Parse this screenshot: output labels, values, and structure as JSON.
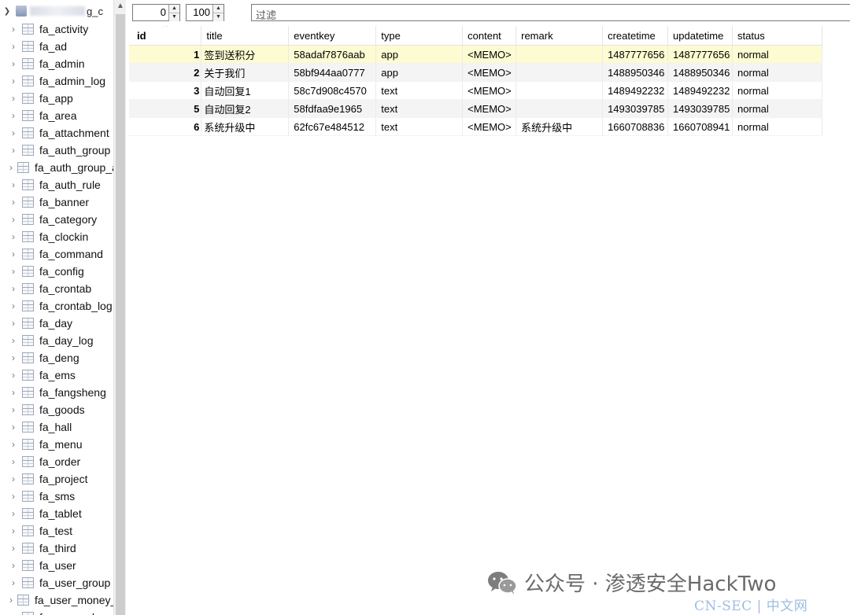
{
  "sidebar": {
    "db_name_tail": "g_c",
    "tables": [
      "fa_activity",
      "fa_ad",
      "fa_admin",
      "fa_admin_log",
      "fa_app",
      "fa_area",
      "fa_attachment",
      "fa_auth_group",
      "fa_auth_group_access",
      "fa_auth_rule",
      "fa_banner",
      "fa_category",
      "fa_clockin",
      "fa_command",
      "fa_config",
      "fa_crontab",
      "fa_crontab_log",
      "fa_day",
      "fa_day_log",
      "fa_deng",
      "fa_ems",
      "fa_fangsheng",
      "fa_goods",
      "fa_hall",
      "fa_menu",
      "fa_order",
      "fa_project",
      "fa_sms",
      "fa_tablet",
      "fa_test",
      "fa_third",
      "fa_user",
      "fa_user_group",
      "fa_user_money_log",
      "fa_user_rule"
    ]
  },
  "toolbar": {
    "offset_value": "0",
    "limit_value": "100",
    "filter_label": "过滤"
  },
  "grid": {
    "columns": [
      "id",
      "title",
      "eventkey",
      "type",
      "content",
      "remark",
      "createtime",
      "updatetime",
      "status"
    ],
    "rows": [
      {
        "id": "1",
        "title": "签到送积分",
        "eventkey": "58adaf7876aab",
        "type": "app",
        "content": "<MEMO>",
        "remark": "",
        "createtime": "1487777656",
        "updatetime": "1487777656",
        "status": "normal"
      },
      {
        "id": "2",
        "title": "关于我们",
        "eventkey": "58bf944aa0777",
        "type": "app",
        "content": "<MEMO>",
        "remark": "",
        "createtime": "1488950346",
        "updatetime": "1488950346",
        "status": "normal"
      },
      {
        "id": "3",
        "title": "自动回复1",
        "eventkey": "58c7d908c4570",
        "type": "text",
        "content": "<MEMO>",
        "remark": "",
        "createtime": "1489492232",
        "updatetime": "1489492232",
        "status": "normal"
      },
      {
        "id": "5",
        "title": "自动回复2",
        "eventkey": "58fdfaa9e1965",
        "type": "text",
        "content": "<MEMO>",
        "remark": "",
        "createtime": "1493039785",
        "updatetime": "1493039785",
        "status": "normal"
      },
      {
        "id": "6",
        "title": "系统升级中",
        "eventkey": "62fc67e484512",
        "type": "text",
        "content": "<MEMO>",
        "remark": "系统升级中",
        "createtime": "1660708836",
        "updatetime": "1660708941",
        "status": "normal"
      }
    ]
  },
  "watermark": {
    "text": "公众号 · 渗透安全HackTwo",
    "site": "CN-SEC | 中文网"
  },
  "colors": {
    "selected_row": "#fdfbd1",
    "alt_row": "#f4f4f4",
    "watermark_site": "#9dbde0"
  }
}
